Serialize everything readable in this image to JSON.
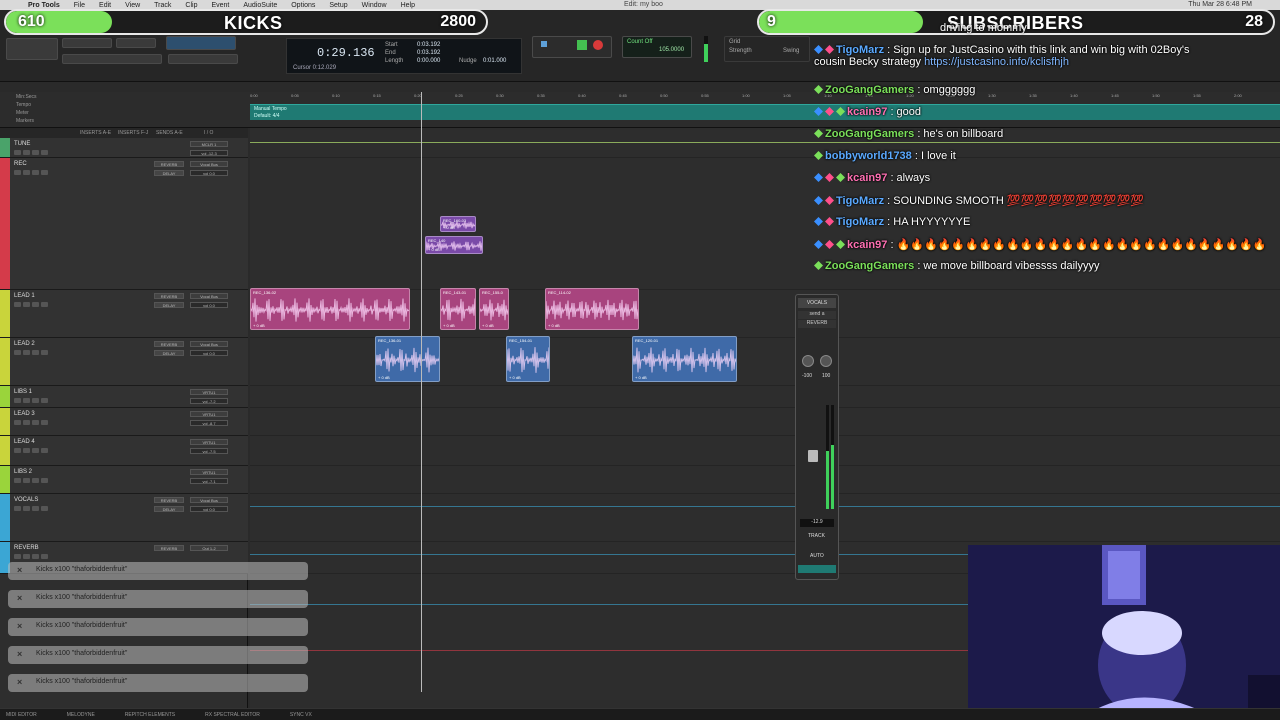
{
  "menubar": {
    "items": [
      "Pro Tools",
      "File",
      "Edit",
      "View",
      "Track",
      "Clip",
      "Event",
      "AudioSuite",
      "Options",
      "Setup",
      "Window",
      "Help"
    ],
    "window_title": "Edit: my boo",
    "clock": "Thu Mar 28  6:48 PM"
  },
  "overlays": {
    "kicks": {
      "count": "610",
      "label": "KICKS",
      "goal": "2800",
      "progress": 0.22,
      "fill_color": "#7be05a"
    },
    "subs": {
      "count": "9",
      "label": "SUBSCRIBERS",
      "goal": "28",
      "progress": 0.32,
      "fill_color": "#7be05a"
    }
  },
  "transport": {
    "counter_main": "0:29.136",
    "counter_sub": "Cursor   0:12.029",
    "labels": {
      "start": "Start",
      "end": "End",
      "length": "Length",
      "nudge": "Nudge",
      "grid": "Grid",
      "strength": "Strength",
      "swing": "Swing"
    },
    "values": {
      "start": "0:03.192",
      "end": "0:03.192",
      "length": "0:00.000",
      "nudge": "0:01.000",
      "tempo": "105.0000",
      "meter": "Count Off"
    }
  },
  "rulers": {
    "labels": [
      "Min:Secs",
      "Tempo",
      "Meter",
      "Markers"
    ],
    "tempo_marker": "Manual Tempo",
    "meter_marker": "Default: 4/4",
    "ticks": [
      "0:00",
      "0:05",
      "0:10",
      "0:15",
      "0:20",
      "0:25",
      "0:30",
      "0:35",
      "0:40",
      "0:45",
      "0:50",
      "0:55",
      "1:00",
      "1:05",
      "1:10",
      "1:15",
      "1:20",
      "1:25",
      "1:30",
      "1:35",
      "1:40",
      "1:45",
      "1:50",
      "1:55",
      "2:00"
    ]
  },
  "column_headers": [
    "INSERTS A-E",
    "INSERTS F-J",
    "SENDS A-E",
    "I / O"
  ],
  "tracks": [
    {
      "name": "TUNE",
      "color": "#4aa36a",
      "insert": "",
      "io": "MCLR 1",
      "vol": "vol -12.3"
    },
    {
      "name": "REC",
      "color": "#d43b4a",
      "insert": "REVERB",
      "send2": "DELAY",
      "io": "Vocal Bus",
      "vol": "vol 0.0"
    },
    {
      "name": "LEAD 1",
      "color": "#c9d43b",
      "insert": "REVERB",
      "send2": "DELAY",
      "io": "Vocal Bus",
      "vol": "vol 0.0"
    },
    {
      "name": "LEAD 2",
      "color": "#c9d43b",
      "insert": "REVERB",
      "send2": "DELAY",
      "io": "Vocal Bus",
      "vol": "vol 0.0"
    },
    {
      "name": "LIBS 1",
      "color": "#9ad43b",
      "insert": "",
      "io": "VRTU1",
      "vol": "vol -7.2"
    },
    {
      "name": "LEAD 3",
      "color": "#c9d43b",
      "insert": "",
      "io": "VRTU1",
      "vol": "vol -8.7"
    },
    {
      "name": "LEAD 4",
      "color": "#c9d43b",
      "insert": "",
      "io": "VRTU1",
      "vol": "vol -7.5"
    },
    {
      "name": "LIBS 2",
      "color": "#9ad43b",
      "insert": "",
      "io": "VRTU1",
      "vol": "vol -7.1"
    },
    {
      "name": "VOCALS",
      "color": "#3ba6d4",
      "insert": "REVERB",
      "send2": "DELAY",
      "io": "Vocal Bus",
      "vol": "vol 0.0"
    },
    {
      "name": "REVERB",
      "color": "#3ba6d4",
      "insert": "REVERB",
      "io": "Out 1-2",
      "vol": ""
    }
  ],
  "clips": [
    {
      "name": "REC_160-03",
      "gain": "+ 0 dB",
      "color": "#7a4aa8"
    },
    {
      "name": "REC_140",
      "gain": "+ 0 dB",
      "color": "#7a4aa8"
    },
    {
      "name": "REC_136-02",
      "gain": "+ 0 dB",
      "color": "#a8447e"
    },
    {
      "name": "REC_143-01",
      "gain": "+ 0 dB",
      "color": "#a8447e"
    },
    {
      "name": "REC_155-0",
      "gain": "+ 0 dB",
      "color": "#a8447e"
    },
    {
      "name": "REC_114-02",
      "gain": "+ 0 dB",
      "color": "#a8447e"
    },
    {
      "name": "REC_136-01",
      "gain": "+ 0 dB",
      "color": "#3f6aa8"
    },
    {
      "name": "REC_154-01",
      "gain": "+ 0 dB",
      "color": "#3f6aa8"
    },
    {
      "name": "REC_120-01",
      "gain": "+ 0 dB",
      "color": "#3f6aa8"
    }
  ],
  "chat": [
    {
      "user": "TigoMarz",
      "user_color": "#5aa9ff",
      "badges": 2,
      "msg": ": Sign up for JustCasino with this link and win big with 02Boy's",
      "msg2": "cousin Becky strategy ",
      "link": "https://justcasino.info/kclisfhjh"
    },
    {
      "user": "ZooGangGamers",
      "user_color": "#7be05a",
      "badges": 1,
      "msg": ": omgggggg"
    },
    {
      "user": "kcain97",
      "user_color": "#ff6fb2",
      "badges": 3,
      "msg": ": good"
    },
    {
      "user": "ZooGangGamers",
      "user_color": "#7be05a",
      "badges": 1,
      "msg": ": he's on billboard"
    },
    {
      "user": "bobbyworld1738",
      "user_color": "#5aa9ff",
      "badges": 1,
      "msg": ": I love it"
    },
    {
      "user": "kcain97",
      "user_color": "#ff6fb2",
      "badges": 3,
      "msg": ": always"
    },
    {
      "user": "TigoMarz",
      "user_color": "#5aa9ff",
      "badges": 2,
      "msg": ": SOUNDING SMOOTH 💯💯💯💯💯💯💯💯💯💯"
    },
    {
      "user": "TigoMarz",
      "user_color": "#5aa9ff",
      "badges": 2,
      "msg": ": HA HYYYYYYE"
    },
    {
      "user": "kcain97",
      "user_color": "#ff6fb2",
      "badges": 3,
      "msg": ": 🔥🔥🔥🔥🔥🔥🔥🔥🔥🔥🔥🔥🔥🔥🔥🔥🔥🔥🔥🔥🔥🔥🔥🔥🔥🔥🔥"
    },
    {
      "user": "ZooGangGamers",
      "user_color": "#7be05a",
      "badges": 1,
      "msg": ": we move billboard vibessss dailyyyy"
    }
  ],
  "chat_partial_top": "driving to mommy",
  "strip": {
    "name": "VOCALS",
    "insert": "send a",
    "send": "REVERB",
    "pan_l": "-100",
    "pan_r": "100",
    "level": "-12.9",
    "mode": "TRACK",
    "auto": "AUTO"
  },
  "notifications": [
    "Kicks x100 \"thaforbiddenfruit\"",
    "Kicks x100 \"thaforbiddenfruit\"",
    "Kicks x100 \"thaforbiddenfruit\"",
    "Kicks x100 \"thaforbiddenfruit\"",
    "Kicks x100 \"thaforbiddenfruit\""
  ],
  "bottom_bar": [
    "MIDI EDITOR",
    "MELODYNE",
    "REPITCH ELEMENTS",
    "RX SPECTRAL EDITOR",
    "SYNC VX"
  ]
}
